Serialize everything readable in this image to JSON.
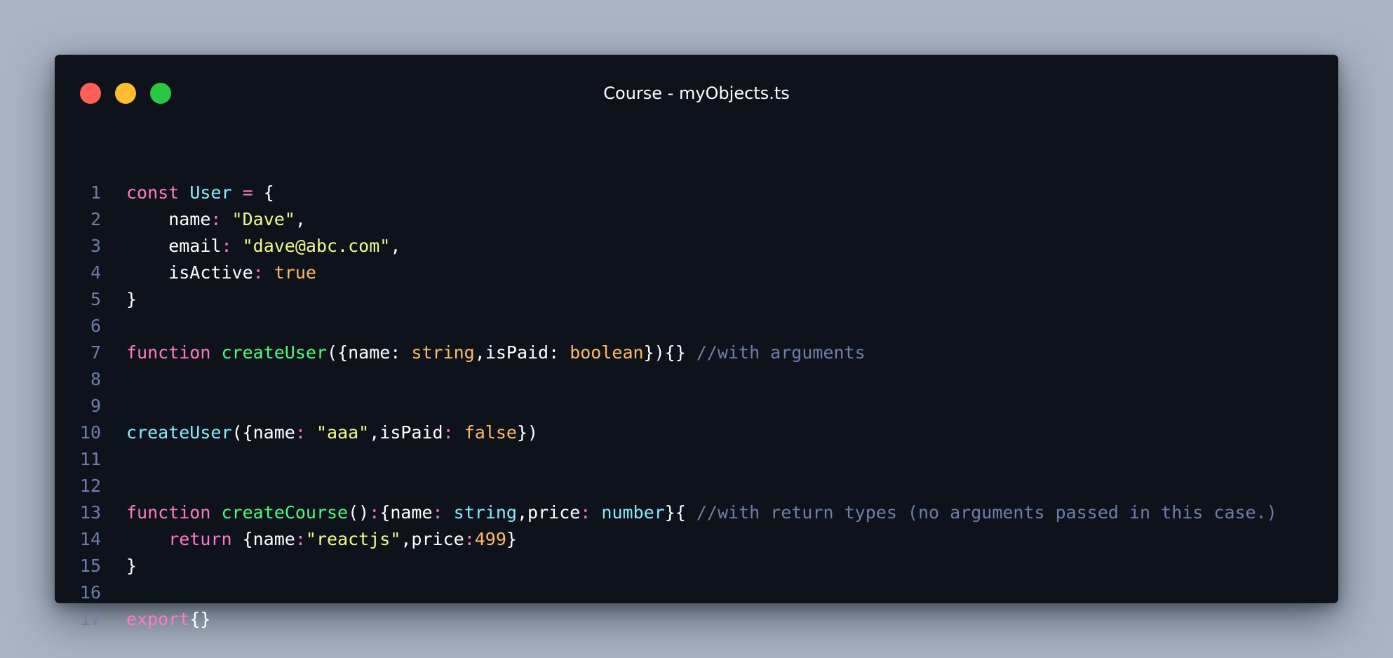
{
  "window": {
    "title": "Course - myObjects.ts",
    "buttons": [
      {
        "name": "close",
        "color": "#ff5f57"
      },
      {
        "name": "minimize",
        "color": "#febc2e"
      },
      {
        "name": "maximize",
        "color": "#28c840"
      }
    ]
  },
  "theme": {
    "background": "#a9b4c2",
    "window_bg": "#0e121a",
    "keyword": "#ff79c6",
    "function": "#50fa7b",
    "identifier": "#8be9fd",
    "string": "#f1fa8c",
    "literal": "#ffb86c",
    "comment": "#6d7fab",
    "operator": "#ff79c6",
    "text": "#ffffff"
  },
  "code": {
    "lines": [
      {
        "num": "1",
        "tokens": [
          {
            "t": "const",
            "c": "keyword"
          },
          {
            "t": " ",
            "c": "text"
          },
          {
            "t": "User",
            "c": "identifier"
          },
          {
            "t": " ",
            "c": "text"
          },
          {
            "t": "=",
            "c": "operator"
          },
          {
            "t": " {",
            "c": "text"
          }
        ]
      },
      {
        "num": "2",
        "tokens": [
          {
            "t": "    name",
            "c": "text"
          },
          {
            "t": ":",
            "c": "operator"
          },
          {
            "t": " ",
            "c": "text"
          },
          {
            "t": "\"Dave\"",
            "c": "string"
          },
          {
            "t": ",",
            "c": "text"
          }
        ]
      },
      {
        "num": "3",
        "tokens": [
          {
            "t": "    email",
            "c": "text"
          },
          {
            "t": ":",
            "c": "operator"
          },
          {
            "t": " ",
            "c": "text"
          },
          {
            "t": "\"dave@abc.com\"",
            "c": "string"
          },
          {
            "t": ",",
            "c": "text"
          }
        ]
      },
      {
        "num": "4",
        "tokens": [
          {
            "t": "    isActive",
            "c": "text"
          },
          {
            "t": ":",
            "c": "operator"
          },
          {
            "t": " ",
            "c": "text"
          },
          {
            "t": "true",
            "c": "literal"
          }
        ]
      },
      {
        "num": "5",
        "tokens": [
          {
            "t": "}",
            "c": "text"
          }
        ]
      },
      {
        "num": "6",
        "tokens": []
      },
      {
        "num": "7",
        "tokens": [
          {
            "t": "function",
            "c": "keyword"
          },
          {
            "t": " ",
            "c": "text"
          },
          {
            "t": "createUser",
            "c": "function"
          },
          {
            "t": "({name: ",
            "c": "text"
          },
          {
            "t": "string",
            "c": "literal"
          },
          {
            "t": ",isPaid: ",
            "c": "text"
          },
          {
            "t": "boolean",
            "c": "literal"
          },
          {
            "t": "}){} ",
            "c": "text"
          },
          {
            "t": "//with arguments",
            "c": "comment"
          }
        ]
      },
      {
        "num": "8",
        "tokens": []
      },
      {
        "num": "9",
        "tokens": []
      },
      {
        "num": "10",
        "tokens": [
          {
            "t": "createUser",
            "c": "identifier"
          },
          {
            "t": "({name",
            "c": "text"
          },
          {
            "t": ":",
            "c": "operator"
          },
          {
            "t": " ",
            "c": "text"
          },
          {
            "t": "\"aaa\"",
            "c": "string"
          },
          {
            "t": ",isPaid",
            "c": "text"
          },
          {
            "t": ":",
            "c": "operator"
          },
          {
            "t": " ",
            "c": "text"
          },
          {
            "t": "false",
            "c": "literal"
          },
          {
            "t": "})",
            "c": "text"
          }
        ]
      },
      {
        "num": "11",
        "tokens": []
      },
      {
        "num": "12",
        "tokens": []
      },
      {
        "num": "13",
        "tokens": [
          {
            "t": "function",
            "c": "keyword"
          },
          {
            "t": " ",
            "c": "text"
          },
          {
            "t": "createCourse",
            "c": "function"
          },
          {
            "t": "()",
            "c": "text"
          },
          {
            "t": ":",
            "c": "operator"
          },
          {
            "t": "{name",
            "c": "text"
          },
          {
            "t": ":",
            "c": "operator"
          },
          {
            "t": " ",
            "c": "text"
          },
          {
            "t": "string",
            "c": "identifier"
          },
          {
            "t": ",price",
            "c": "text"
          },
          {
            "t": ":",
            "c": "operator"
          },
          {
            "t": " ",
            "c": "text"
          },
          {
            "t": "number",
            "c": "identifier"
          },
          {
            "t": "}{ ",
            "c": "text"
          },
          {
            "t": "//with return types (no arguments passed in this case.)",
            "c": "comment"
          }
        ]
      },
      {
        "num": "14",
        "tokens": [
          {
            "t": "    ",
            "c": "text"
          },
          {
            "t": "return",
            "c": "keyword"
          },
          {
            "t": " {name",
            "c": "text"
          },
          {
            "t": ":",
            "c": "operator"
          },
          {
            "t": "\"reactjs\"",
            "c": "string"
          },
          {
            "t": ",price",
            "c": "text"
          },
          {
            "t": ":",
            "c": "operator"
          },
          {
            "t": "499",
            "c": "literal"
          },
          {
            "t": "}",
            "c": "text"
          }
        ]
      },
      {
        "num": "15",
        "tokens": [
          {
            "t": "}",
            "c": "text"
          }
        ]
      },
      {
        "num": "16",
        "tokens": []
      },
      {
        "num": "17",
        "tokens": [
          {
            "t": "export",
            "c": "keyword"
          },
          {
            "t": "{}",
            "c": "text"
          }
        ]
      }
    ]
  }
}
